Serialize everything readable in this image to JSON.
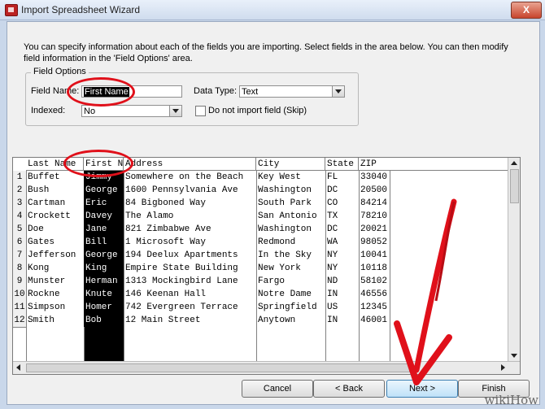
{
  "window": {
    "title": "Import Spreadsheet Wizard",
    "close_label": "X"
  },
  "intro_text": "You can specify information about each of the fields you are importing. Select fields in the area below. You can then modify field information in the 'Field Options' area.",
  "field_options": {
    "legend": "Field Options",
    "field_name_label": "Field Name:",
    "field_name_value": "First Name",
    "data_type_label": "Data Type:",
    "data_type_value": "Text",
    "indexed_label": "Indexed:",
    "indexed_value": "No",
    "skip_label": "Do not import field (Skip)"
  },
  "grid": {
    "columns": [
      "Last Name",
      "First N",
      "Address",
      "City",
      "State",
      "ZIP"
    ],
    "rows": [
      [
        "1",
        "Buffet",
        "Jimmy",
        "Somewhere on the Beach",
        "Key West",
        "FL",
        "33040"
      ],
      [
        "2",
        "Bush",
        "George",
        "1600 Pennsylvania Ave",
        "Washington",
        "DC",
        "20500"
      ],
      [
        "3",
        "Cartman",
        "Eric",
        "84 Bigboned Way",
        "South Park",
        "CO",
        "84214"
      ],
      [
        "4",
        "Crockett",
        "Davey",
        "The Alamo",
        "San Antonio",
        "TX",
        "78210"
      ],
      [
        "5",
        "Doe",
        "Jane",
        "821 Zimbabwe Ave",
        "Washington",
        "DC",
        "20021"
      ],
      [
        "6",
        "Gates",
        "Bill",
        "1 Microsoft Way",
        "Redmond",
        "WA",
        "98052"
      ],
      [
        "7",
        "Jefferson",
        "George",
        "194 Deelux Apartments",
        "In the Sky",
        "NY",
        "10041"
      ],
      [
        "8",
        "Kong",
        "King",
        "Empire State Building",
        "New York",
        "NY",
        "10118"
      ],
      [
        "9",
        "Munster",
        "Herman",
        "1313 Mockingbird Lane",
        "Fargo",
        "ND",
        "58102"
      ],
      [
        "10",
        "Rockne",
        "Knute",
        "146 Keenan Hall",
        "Notre Dame",
        "IN",
        "46556"
      ],
      [
        "11",
        "Simpson",
        "Homer",
        "742 Evergreen Terrace",
        "Springfield",
        "US",
        "12345"
      ],
      [
        "12",
        "Smith",
        "Bob",
        "12 Main Street",
        "Anytown",
        "IN",
        "46001"
      ]
    ]
  },
  "buttons": {
    "cancel": "Cancel",
    "back": "< Back",
    "next": "Next >",
    "finish": "Finish"
  },
  "watermark": "wikiHow",
  "colors": {
    "annotation": "#e0101a",
    "title_bar": "#cfdcee"
  }
}
